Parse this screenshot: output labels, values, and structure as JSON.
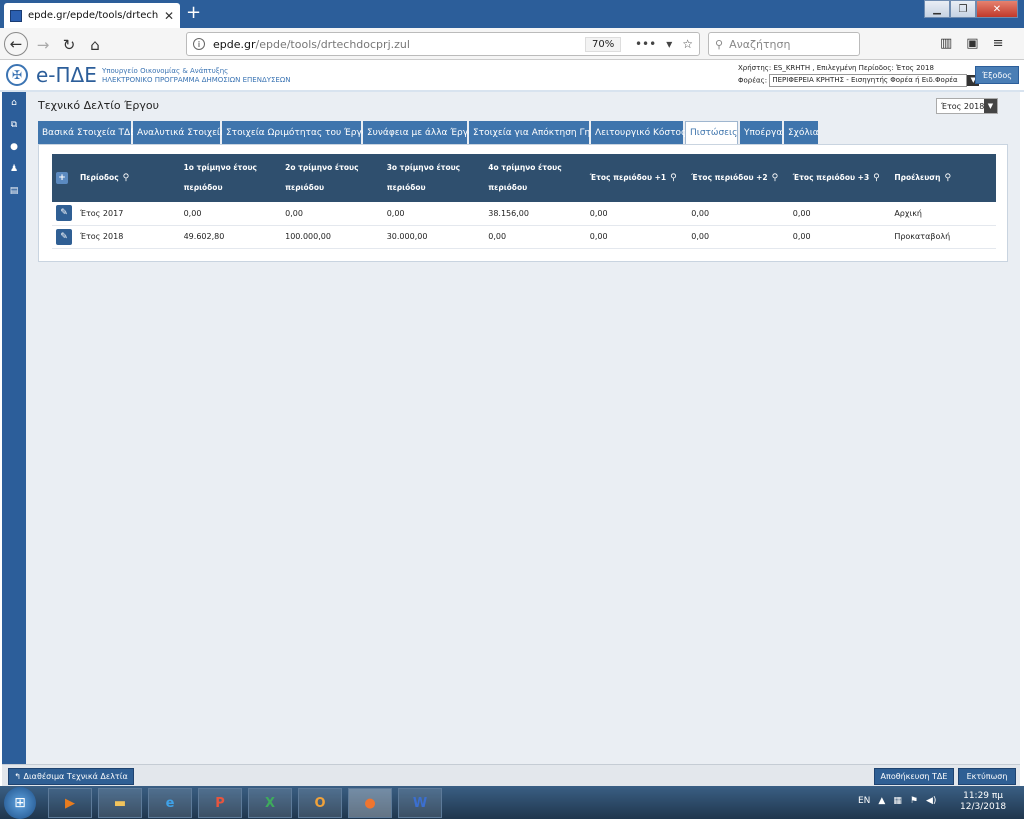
{
  "browser": {
    "tab_title": "epde.gr/epde/tools/drtechdoc",
    "url_domain": "epde.gr",
    "url_path": "/epde/tools/drtechdocprj.zul",
    "zoom": "70%",
    "search_placeholder": "Αναζήτηση"
  },
  "app": {
    "logo": "e-ΠΔΕ",
    "ministry": "Υπουργείο Οικονομίας & Ανάπτυξης",
    "program": "ΗΛΕΚΤΡΟΝΙΚΟ ΠΡΟΓΡΑΜΜΑ ΔΗΜΟΣΙΩΝ ΕΠΕΝΔΥΣΕΩΝ",
    "user_line": "Χρήστης: ES_KRHTH , Επιλεγμένη Περίοδος: Έτος 2018",
    "foreas_label": "Φορέας:",
    "foreas_value": "ΠΕΡΙΦΕΡΕΙΑ ΚΡΗΤΗΣ - Εισηγητής Φορέα ή Ειδ.Φορέα",
    "exit_label": "Έξοδος"
  },
  "page": {
    "title": "Τεχνικό Δελτίο Έργου",
    "year_select": "Έτος 2018",
    "tabs": [
      "Βασικά Στοιχεία ΤΔΕ",
      "Αναλυτικά Στοιχεία",
      "Στοιχεία Ωριμότητας του Έργου",
      "Συνάφεια με άλλα Έργα",
      "Στοιχεία για Απόκτηση Γης",
      "Λειτουργικό Κόστος",
      "Πιστώσεις",
      "Υποέργα",
      "Σχόλια"
    ],
    "active_tab": "Πιστώσεις"
  },
  "table": {
    "headers": {
      "period": "Περίοδος",
      "q1_a": "1ο τρίμηνο έτους",
      "q1_b": "περιόδου",
      "q2_a": "2ο τρίμηνο έτους",
      "q2_b": "περιόδου",
      "q3_a": "3ο τρίμηνο έτους",
      "q3_b": "περιόδου",
      "q4_a": "4ο τρίμηνο έτους",
      "q4_b": "περιόδου",
      "y1": "Έτος περιόδου +1",
      "y2": "Έτος περιόδου +2",
      "y3": "Έτος περιόδου +3",
      "origin": "Προέλευση"
    },
    "rows": [
      {
        "period": "Έτος 2017",
        "q1": "0,00",
        "q2": "0,00",
        "q3": "0,00",
        "q4": "38.156,00",
        "y1": "0,00",
        "y2": "0,00",
        "y3": "0,00",
        "origin": "Αρχική"
      },
      {
        "period": "Έτος 2018",
        "q1": "49.602,80",
        "q2": "100.000,00",
        "q3": "30.000,00",
        "q4": "0,00",
        "y1": "0,00",
        "y2": "0,00",
        "y3": "0,00",
        "origin": "Προκαταβολή"
      }
    ]
  },
  "footer": {
    "back_label": "Διαθέσιμα Τεχνικά Δελτία",
    "save_label": "Αποθήκευση ΤΔΕ",
    "print_label": "Εκτύπωση"
  },
  "taskbar": {
    "lang": "EN",
    "time": "11:29 πμ",
    "date": "12/3/2018"
  }
}
